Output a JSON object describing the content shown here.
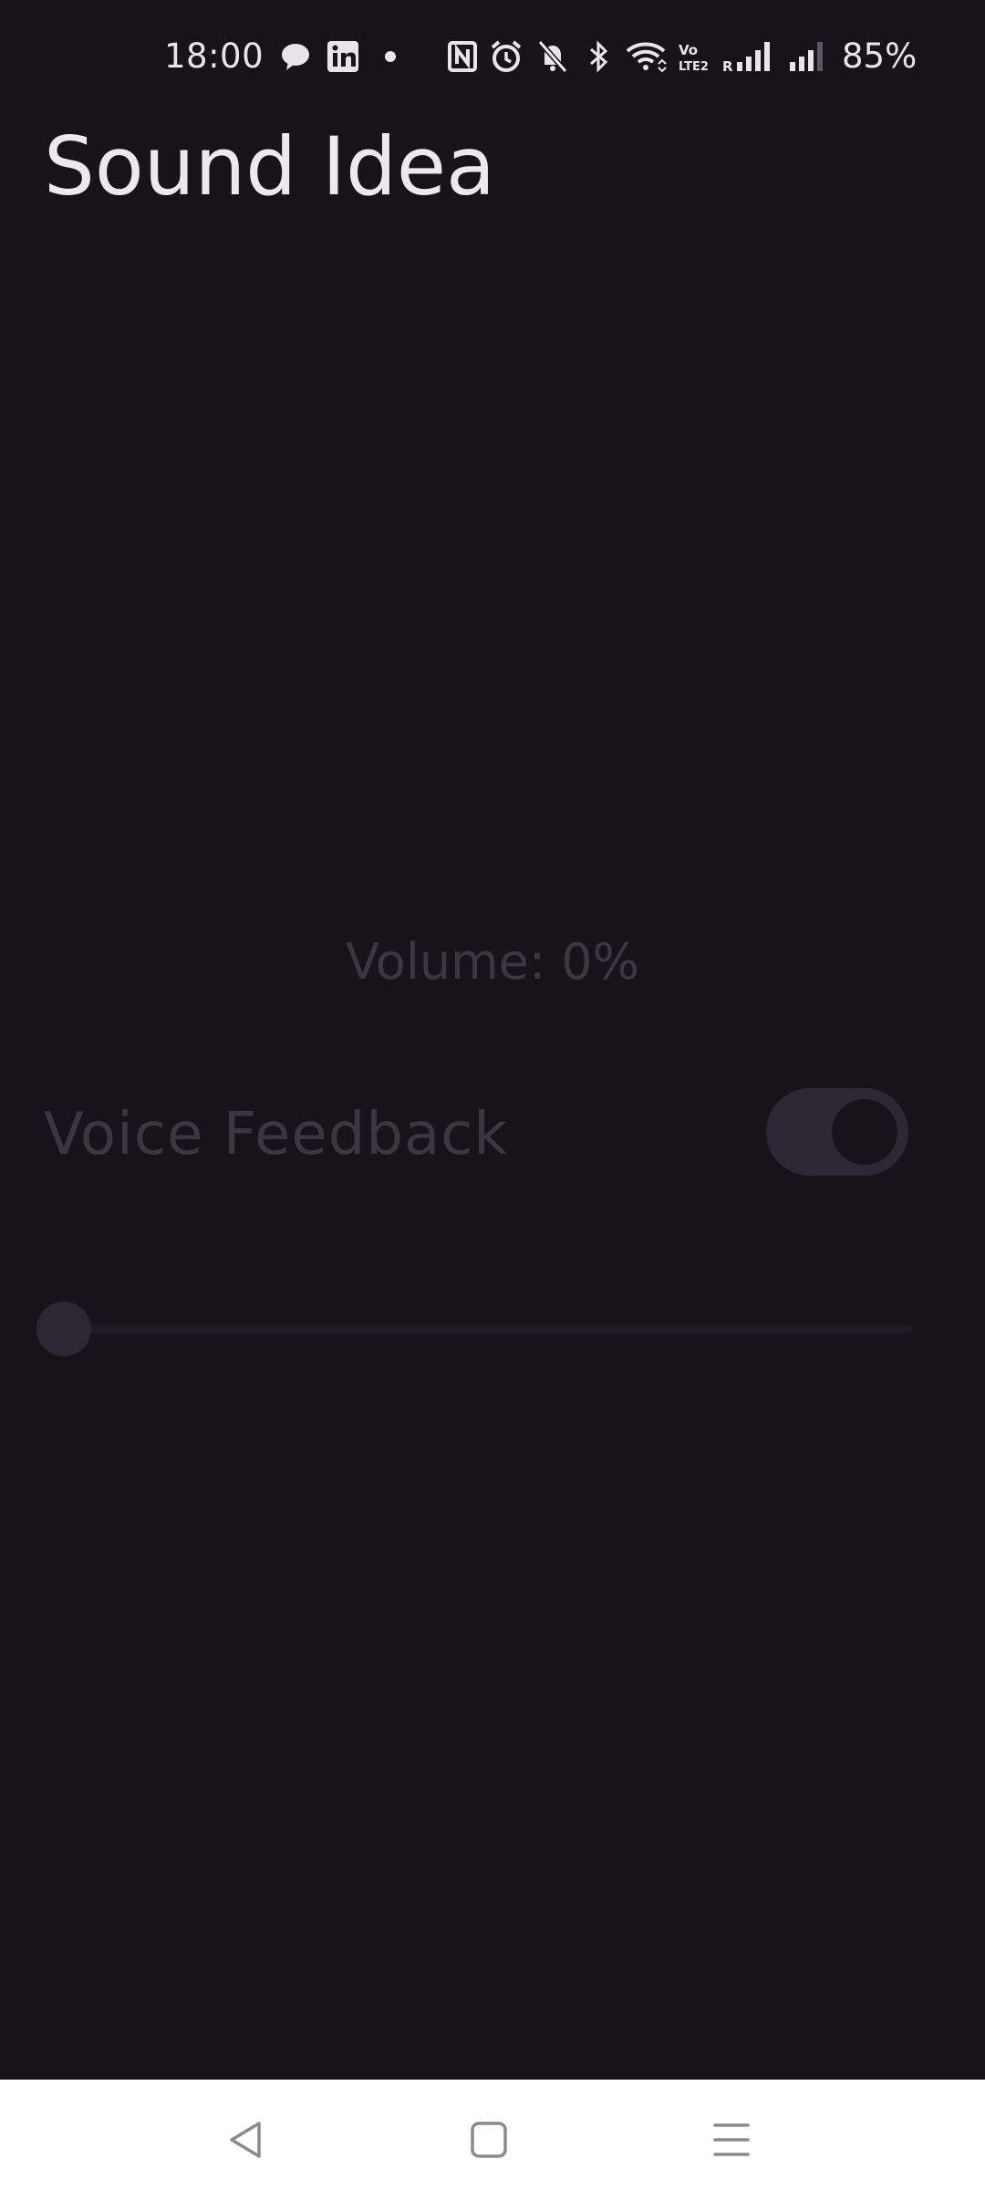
{
  "status_bar": {
    "time": "18:00",
    "battery": "85%",
    "icons": [
      "chat-bubble-icon",
      "linkedin-icon",
      "dot-icon",
      "nfc-icon",
      "alarm-icon",
      "bell-off-icon",
      "bluetooth-icon",
      "wifi-icon",
      "volte-icon",
      "signal-icon",
      "signal-icon-2"
    ]
  },
  "app": {
    "title": "Sound Idea"
  },
  "volume": {
    "label": "Volume: 0%",
    "value_percent": 0
  },
  "voice_feedback": {
    "label": "Voice Feedback",
    "enabled": true
  },
  "nav_bar": {
    "buttons": [
      "back-icon",
      "home-icon",
      "menu-icon"
    ]
  },
  "colors": {
    "background": "#16131b",
    "title_text": "#ece8ef",
    "disabled_text": "#3a3740",
    "toggle_track": "#2b2833",
    "nav_bar": "#ffffff",
    "nav_icon": "#8a8a8a"
  }
}
